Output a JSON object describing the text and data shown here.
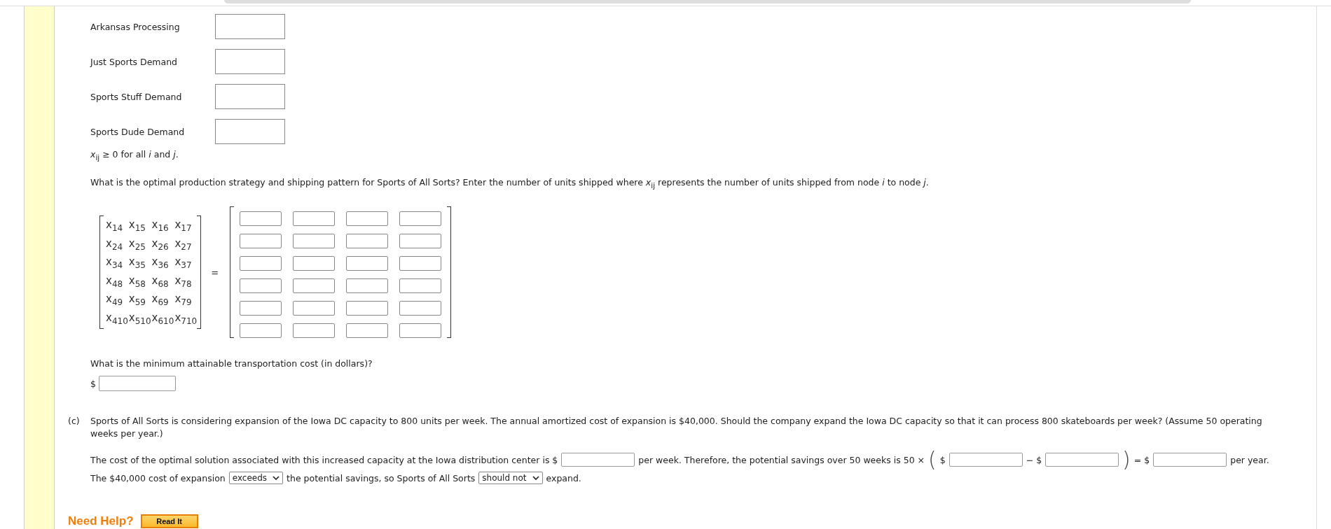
{
  "constraint_rows": [
    {
      "label": "Arkansas Processing"
    },
    {
      "label": "Just Sports Demand"
    },
    {
      "label": "Sports Stuff Demand"
    },
    {
      "label": "Sports Dude Demand"
    }
  ],
  "nonnegativity": "*x*$_{ij}$ ≥ 0 for all *i* and *j*.",
  "question_1": "What is the optimal production strategy and shipping pattern for Sports of All Sorts? Enter the number of units shipped where *x*$_{ij}$ represents the number of units shipped from node *i* to node *j*.",
  "variable_matrix": [
    [
      "x$_{14}$",
      "x$_{15}$",
      "x$_{16}$",
      "x$_{17}$"
    ],
    [
      "x$_{24}$",
      "x$_{25}$",
      "x$_{26}$",
      "x$_{27}$"
    ],
    [
      "x$_{34}$",
      "x$_{35}$",
      "x$_{36}$",
      "x$_{37}$"
    ],
    [
      "x$_{48}$",
      "x$_{58}$",
      "x$_{68}$",
      "x$_{78}$"
    ],
    [
      "x$_{49}$",
      "x$_{59}$",
      "x$_{69}$",
      "x$_{79}$"
    ],
    [
      "x$_{410}$",
      "x$_{510}$",
      "x$_{610}$",
      "x$_{710}$"
    ]
  ],
  "equals": "=",
  "question_2": "What is the minimum attainable transportation cost (in dollars)?",
  "cost_prefix": "$",
  "part_c": {
    "marker": "(c)",
    "text": "Sports of All Sorts is considering expansion of the Iowa DC capacity to 800 units per week. The annual amortized cost of expansion is $40,000. Should the company expand the Iowa DC capacity so that it can process 800 skateboards per week? (Assume 50 operating weeks per year.)",
    "lines": [
      [
        {
          "kind": "text",
          "text": "The cost of the optimal solution associated with this increased capacity at the Iowa distribution center is $"
        },
        {
          "kind": "field"
        },
        {
          "kind": "text",
          "text": "per week. Therefore, the potential savings over 50 weeks is 50 ×"
        },
        {
          "kind": "paren",
          "text": "("
        },
        {
          "kind": "text",
          "text": "$"
        },
        {
          "kind": "field"
        },
        {
          "kind": "text",
          "text": "− $"
        },
        {
          "kind": "field"
        },
        {
          "kind": "paren",
          "text": ")"
        },
        {
          "kind": "text",
          "text": "= $"
        },
        {
          "kind": "field"
        },
        {
          "kind": "text",
          "text": "per year."
        }
      ],
      [
        {
          "kind": "text",
          "text": "The $40,000 cost of expansion"
        },
        {
          "kind": "select",
          "value": "exceeds"
        },
        {
          "kind": "text",
          "text": "the potential savings, so Sports of All Sorts"
        },
        {
          "kind": "select",
          "value": "should not"
        },
        {
          "kind": "text",
          "text": "expand."
        }
      ]
    ]
  },
  "help": {
    "title": "Need Help?",
    "button": "Read It"
  }
}
